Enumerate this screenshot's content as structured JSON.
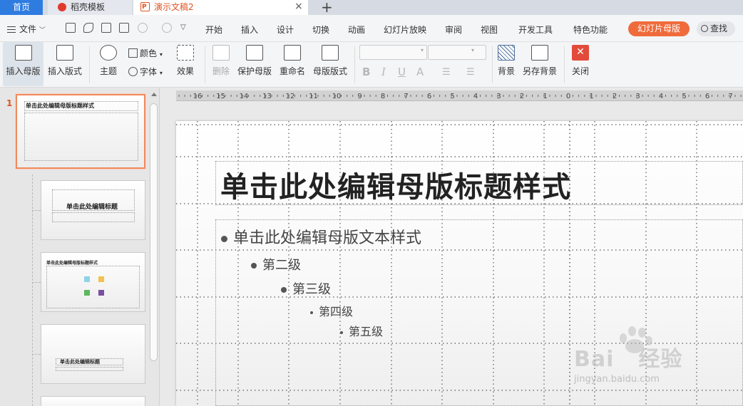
{
  "tabs": {
    "home": "首页",
    "template": "稻壳模板",
    "document": "演示文稿2",
    "close_glyph": "×",
    "add_glyph": "+"
  },
  "menu": {
    "file": "文件",
    "items": [
      "开始",
      "插入",
      "设计",
      "切换",
      "动画",
      "幻灯片放映",
      "审阅",
      "视图",
      "开发工具",
      "特色功能"
    ],
    "active_pill": "幻灯片母版",
    "search": "查找",
    "accent_color": "#f06b3b"
  },
  "ribbon": {
    "insert_master": "插入母版",
    "insert_layout": "插入版式",
    "theme": "主题",
    "color": "颜色",
    "font": "字体",
    "effect": "效果",
    "delete": "删除",
    "protect_master": "保护母版",
    "rename": "重命名",
    "master_layout": "母版版式",
    "background": "背景",
    "save_background": "另存背景",
    "close": "关闭",
    "format_glyphs": [
      "B",
      "I",
      "U",
      "A"
    ]
  },
  "thumbnails": {
    "slide_number": "1",
    "thumb1_title": "单击此处编辑母版标题样式",
    "thumb2_title": "单击此处编辑标题",
    "thumb3_title": "单击此处编辑母版标题样式",
    "thumb4_title": "单击此处编辑标题"
  },
  "ruler": {
    "labels": [
      "16",
      "15",
      "14",
      "13",
      "12",
      "11",
      "10",
      "9",
      "8",
      "7",
      "6",
      "5",
      "4",
      "3",
      "2",
      "1",
      "0",
      "1",
      "2",
      "3",
      "4",
      "5",
      "6",
      "7"
    ]
  },
  "slide": {
    "title": "单击此处编辑母版标题样式",
    "level1": "单击此处编辑母版文本样式",
    "level2": "第二级",
    "level3": "第三级",
    "level4": "第四级",
    "level5": "第五级"
  },
  "watermark": {
    "brand": "Bai",
    "brand_tail": "经验",
    "url": "jingyan.baidu.com"
  }
}
